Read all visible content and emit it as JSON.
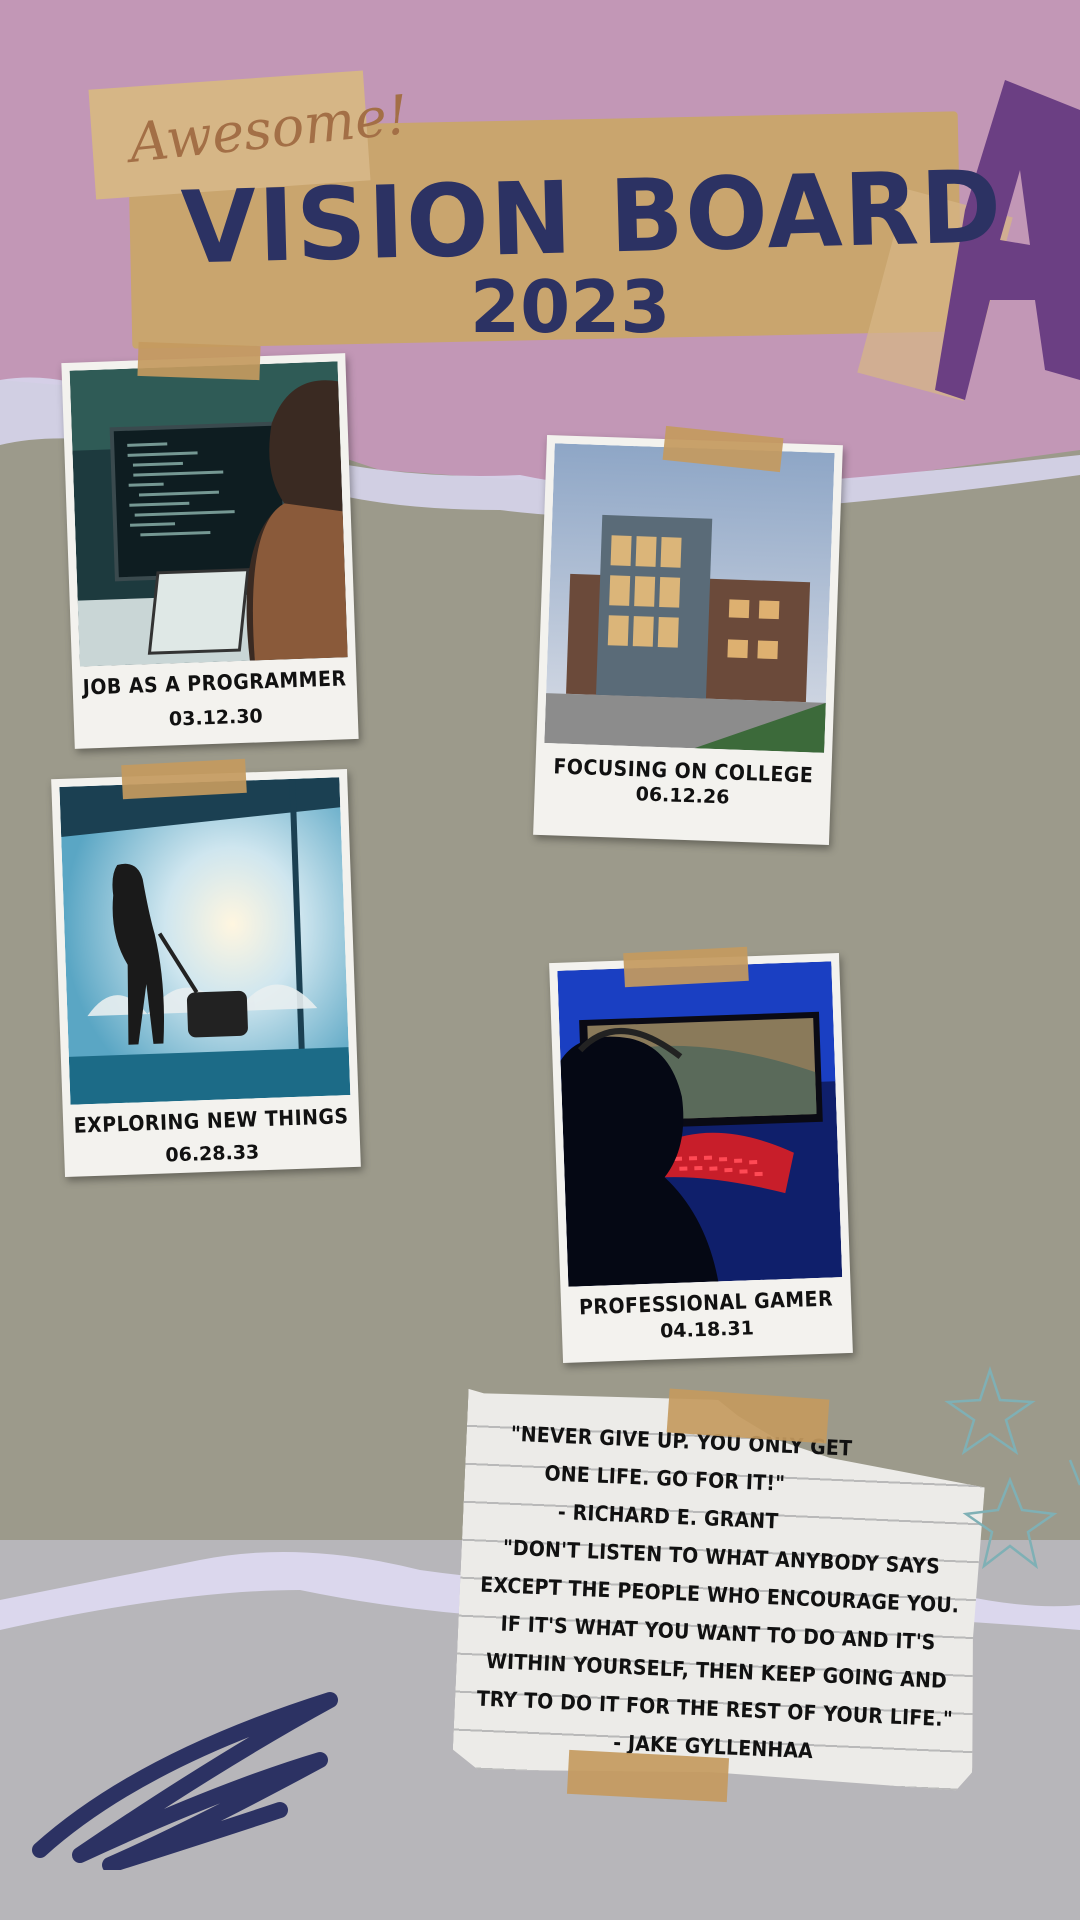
{
  "header": {
    "badge": "Awesome!",
    "title": "VISION BOARD",
    "year": "2023"
  },
  "cards": [
    {
      "caption": "JOB AS A PROGRAMMER",
      "date": "03.12.30",
      "photo_icon": "programmer-photo"
    },
    {
      "caption": "FOCUSING ON COLLEGE",
      "date": "06.12.26",
      "photo_icon": "college-building-photo"
    },
    {
      "caption": "EXPLORING NEW THINGS",
      "date": "06.28.33",
      "photo_icon": "traveler-airport-photo"
    },
    {
      "caption": "PROFESSIONAL GAMER",
      "date": "04.18.31",
      "photo_icon": "gamer-photo"
    }
  ],
  "quote": {
    "lines": [
      "\"NEVER GIVE UP. YOU ONLY GET",
      "ONE LIFE. GO FOR IT!\"",
      "- RICHARD E. GRANT",
      "\"DON'T LISTEN TO WHAT ANYBODY SAYS",
      "EXCEPT THE PEOPLE WHO ENCOURAGE YOU.",
      "IF IT'S WHAT YOU WANT TO DO AND IT'S",
      "WITHIN YOURSELF, THEN KEEP GOING AND",
      "TRY TO DO IT FOR THE REST OF YOUR LIFE.\"",
      "- JAKE GYLLENHAA"
    ]
  },
  "colors": {
    "title": "#2c3263",
    "tape": "#c9a56e",
    "top_band": "#c297b6",
    "middle_band": "#9c9a8b",
    "bottom_band": "#b7b6ba",
    "accent_purple": "#6b3f83"
  }
}
